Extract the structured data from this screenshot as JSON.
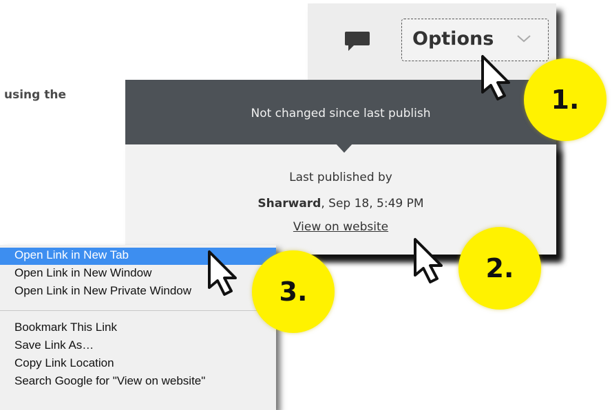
{
  "intro": {
    "text": "using the"
  },
  "options_button": {
    "label": "Options"
  },
  "tooltip": {
    "text": "Not changed since last publish"
  },
  "publish": {
    "line1": "Last published by",
    "author": "Sharward",
    "date": ", Sep 18, 5:49 PM",
    "link": "View on website"
  },
  "context_menu": {
    "items": [
      "Open Link in New Tab",
      "Open Link in New Window",
      "Open Link in New Private Window",
      "Bookmark This Link",
      "Save Link As…",
      "Copy Link Location",
      "Search Google for \"View on website\""
    ],
    "highlight_color": "#3d8ef0"
  },
  "steps": [
    "1.",
    "2.",
    "3."
  ],
  "colors": {
    "badge": "#fff200",
    "tooltip_bg": "#4d5257"
  },
  "icons": {
    "comment": "comment-icon",
    "chevron": "chevron-down-icon",
    "cursor": "cursor-arrow-icon"
  }
}
